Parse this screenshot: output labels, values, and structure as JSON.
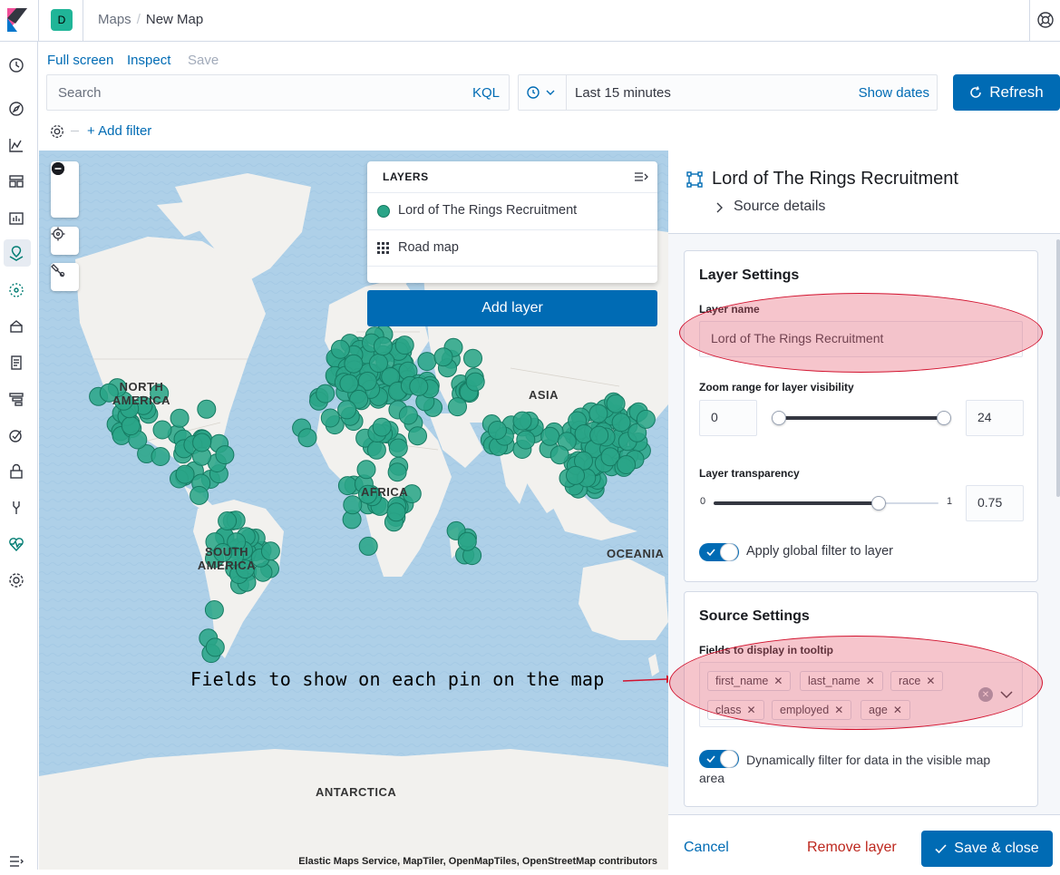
{
  "header": {
    "space_initial": "D",
    "breadcrumbs": [
      "Maps",
      "New Map"
    ]
  },
  "actions": {
    "full_screen": "Full screen",
    "inspect": "Inspect",
    "save": "Save"
  },
  "query_bar": {
    "search_placeholder": "Search",
    "language": "KQL",
    "time_range": "Last 15 minutes",
    "show_dates": "Show dates",
    "refresh": "Refresh",
    "add_filter": "+ Add filter"
  },
  "map": {
    "labels": {
      "north_america": "NORTH AMERICA",
      "asia": "ASIA",
      "africa": "AFRICA",
      "south_america": "SOUTH AMERICA",
      "oceania": "OCEANIA",
      "antarctica": "ANTARCTICA"
    },
    "attribution": "Elastic Maps Service, MapTiler, OpenMapTiles, OpenStreetMap contributors",
    "point_color": "#2aa588",
    "annotation": "Fields to show on each pin on the map"
  },
  "layers_panel": {
    "title": "LAYERS",
    "layers": [
      {
        "name": "Lord of The Rings Recruitment",
        "icon": "circle-icon"
      },
      {
        "name": "Road map",
        "icon": "grid-icon"
      }
    ],
    "add_layer": "Add layer"
  },
  "right_panel": {
    "title": "Lord of The Rings Recruitment",
    "source_details": "Source details",
    "layer_settings": {
      "title": "Layer Settings",
      "layer_name_label": "Layer name",
      "layer_name_value": "Lord of The Rings Recruitment",
      "zoom_label": "Zoom range for layer visibility",
      "zoom_min": "0",
      "zoom_max": "24",
      "transparency_label": "Layer transparency",
      "transparency_min": "0",
      "transparency_max": "1",
      "transparency_value": "0.75",
      "global_filter_label": "Apply global filter to layer"
    },
    "source_settings": {
      "title": "Source Settings",
      "tooltip_fields_label": "Fields to display in tooltip",
      "tooltip_fields": [
        "first_name",
        "last_name",
        "race",
        "class",
        "employed",
        "age"
      ],
      "dynamic_filter_label": "Dynamically filter for data in the visible map area"
    },
    "footer": {
      "cancel": "Cancel",
      "remove_layer": "Remove layer",
      "save_close": "Save & close"
    }
  }
}
